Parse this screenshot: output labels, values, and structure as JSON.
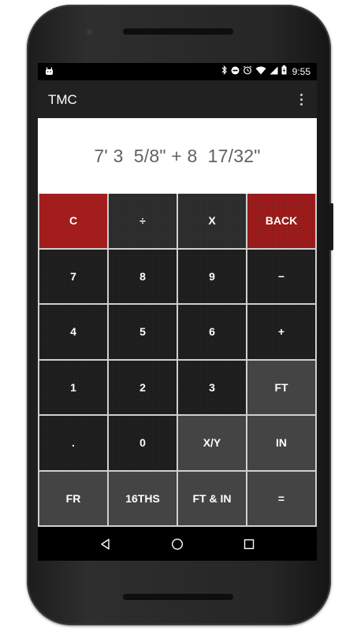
{
  "status_bar": {
    "time": "9:55"
  },
  "app_bar": {
    "title": "TMC"
  },
  "display": {
    "expression": "7' 3  5/8\" + 8  17/32\""
  },
  "keypad": {
    "rows": [
      [
        "C",
        "÷",
        "X",
        "BACK"
      ],
      [
        "7",
        "8",
        "9",
        "−"
      ],
      [
        "4",
        "5",
        "6",
        "+"
      ],
      [
        "1",
        "2",
        "3",
        "FT"
      ],
      [
        ".",
        "0",
        "X/Y",
        "IN"
      ],
      [
        "FR",
        "16THS",
        "FT & IN",
        "="
      ]
    ]
  },
  "colors": {
    "clear_key": "#a31d1d",
    "back_key": "#a31d1d",
    "number_key": "#1b1b1b",
    "function_key": "#444444",
    "app_bar": "#212121",
    "display_text": "#616161"
  }
}
